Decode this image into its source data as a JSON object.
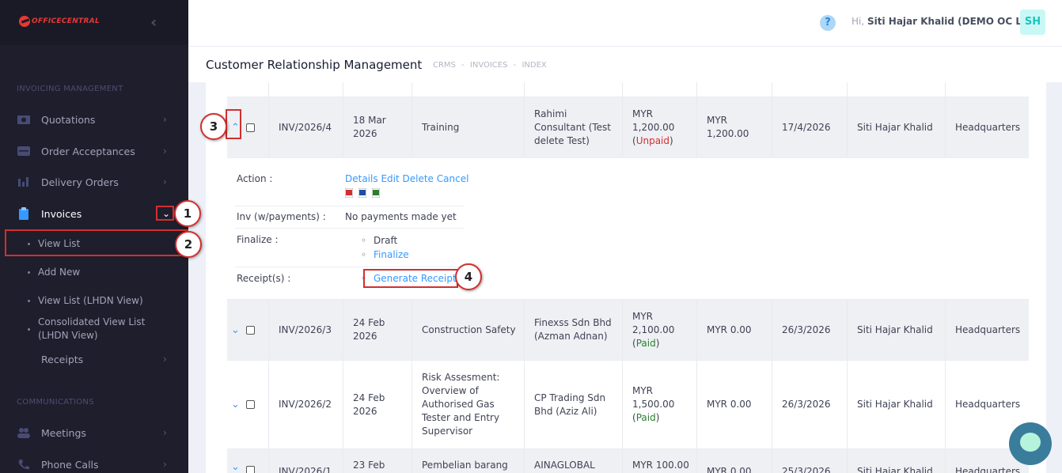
{
  "brand": {
    "logo_text": "OFFICECENTRAL"
  },
  "sidebar": {
    "section_invoicing": "INVOICING MANAGEMENT",
    "quotations": "Quotations",
    "order_acceptances": "Order Acceptances",
    "delivery_orders": "Delivery Orders",
    "invoices": "Invoices",
    "sub": {
      "view_list": "View List",
      "add_new": "Add New",
      "view_list_lhdn": "View List (LHDN View)",
      "consolidated_1": "Consolidated View List",
      "consolidated_2": "(LHDN View)"
    },
    "receipts": "Receipts",
    "section_comm": "COMMUNICATIONS",
    "meetings": "Meetings",
    "phone_calls": "Phone Calls"
  },
  "header": {
    "help": "?",
    "greeting": "Hi,",
    "user": "Siti Hajar Khalid (DEMO OC LITE)",
    "avatar": "SH"
  },
  "subheader": {
    "title": "Customer Relationship Management",
    "crumb1": "CRMS",
    "crumb2": "INVOICES",
    "crumb3": "INDEX",
    "sep": "-"
  },
  "rows": [
    {
      "no": "INV/2026/4",
      "date1": "18 Mar",
      "date2": "2026",
      "desc1": "Training",
      "cust1": "Rahimi",
      "cust2": "Consultant (Test",
      "cust3": "delete Test)",
      "amt1": "MYR",
      "amt2": "1,200.00",
      "status": "Unpaid",
      "bal1": "MYR",
      "bal2": "1,200.00",
      "due": "17/4/2026",
      "owner": "Siti Hajar Khalid",
      "branch": "Headquarters"
    },
    {
      "no": "INV/2026/3",
      "date1": "24 Feb",
      "date2": "2026",
      "desc1": "Construction Safety",
      "cust1": "Finexss Sdn Bhd",
      "cust2": "(Azman Adnan)",
      "amt1": "MYR",
      "amt2": "2,100.00",
      "status": "Paid",
      "bal": "MYR 0.00",
      "due": "26/3/2026",
      "owner": "Siti Hajar Khalid",
      "branch": "Headquarters"
    },
    {
      "no": "INV/2026/2",
      "date1": "24 Feb",
      "date2": "2026",
      "desc1": "Risk Assesment:",
      "desc2": "Overview of",
      "desc3": "Authorised Gas",
      "desc4": "Tester and Entry",
      "desc5": "Supervisor",
      "cust1": "CP Trading Sdn",
      "cust2": "Bhd (Aziz Ali)",
      "amt1": "MYR",
      "amt2": "1,500.00",
      "status": "Paid",
      "bal": "MYR 0.00",
      "due": "26/3/2026",
      "owner": "Siti Hajar Khalid",
      "branch": "Headquarters"
    },
    {
      "no": "INV/2026/1",
      "date1": "23 Feb",
      "desc1": "Pembelian barang",
      "cust1": "AINAGLOBAL",
      "amt1": "MYR 100.00",
      "bal": "MYR 0.00",
      "due": "25/3/2026",
      "owner": "Siti Hajar Khalid",
      "branch": "Headquarters"
    }
  ],
  "detail": {
    "action_label": "Action :",
    "details": "Details",
    "edit": "Edit",
    "delete": "Delete",
    "cancel": "Cancel",
    "inv_label": "Inv (w/payments) :",
    "inv_value": "No payments made yet",
    "finalize_label": "Finalize :",
    "draft": "Draft",
    "finalize": "Finalize",
    "receipts_label": "Receipt(s) :",
    "generate_receipt": "Generate Receipt"
  },
  "markers": {
    "m1": "1",
    "m2": "2",
    "m3": "3",
    "m4": "4"
  },
  "colors": {
    "sidebar": "#1e1e2d",
    "link": "#3699ff",
    "unpaid": "#d32f2f",
    "paid": "#2e7d32",
    "highlight": "#d32f2f"
  }
}
